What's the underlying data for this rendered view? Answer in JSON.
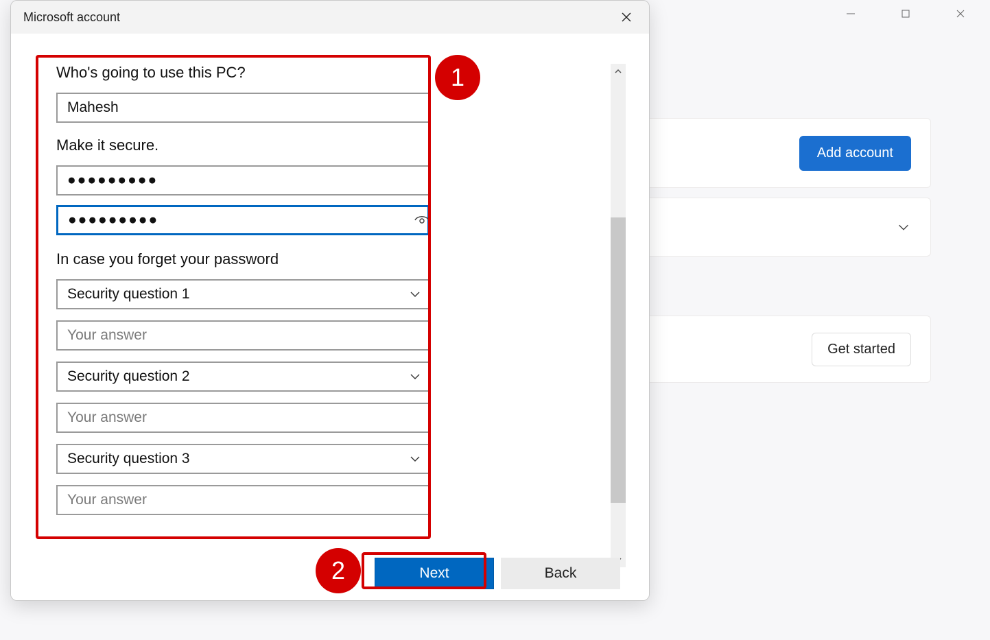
{
  "background": {
    "add_account_label": "Add account",
    "get_started_label": "Get started"
  },
  "dialog": {
    "title": "Microsoft account",
    "section_user": "Who's going to use this PC?",
    "username_value": "Mahesh",
    "section_secure": "Make it secure.",
    "password_value": "●●●●●●●●●",
    "confirm_value": "●●●●●●●●●",
    "section_forget": "In case you forget your password",
    "questions": [
      {
        "label": "Security question 1",
        "answer_placeholder": "Your answer"
      },
      {
        "label": "Security question 2",
        "answer_placeholder": "Your answer"
      },
      {
        "label": "Security question 3",
        "answer_placeholder": "Your answer"
      }
    ],
    "next_label": "Next",
    "back_label": "Back"
  },
  "annotations": {
    "badge1": "1",
    "badge2": "2"
  }
}
